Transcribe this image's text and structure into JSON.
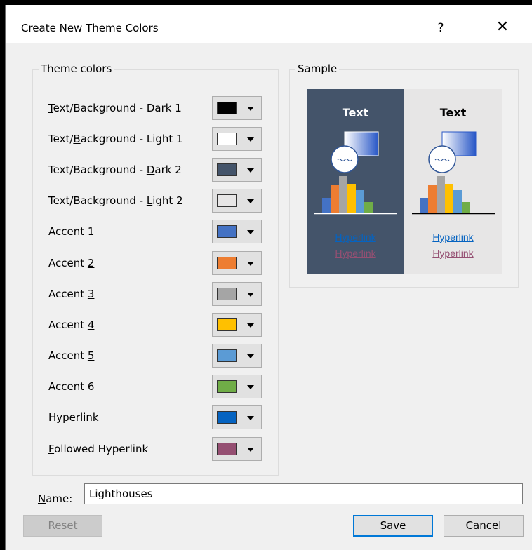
{
  "window": {
    "title": "Create New Theme Colors",
    "help_label": "?",
    "close_label": "✕"
  },
  "theme_colors": {
    "legend": "Theme colors",
    "items": [
      {
        "pre": "",
        "key": "T",
        "post": "ext/Background - Dark 1",
        "color": "#000000"
      },
      {
        "pre": "Text/",
        "key": "B",
        "post": "ackground - Light 1",
        "color": "#ffffff"
      },
      {
        "pre": "Text/Background - ",
        "key": "D",
        "post": "ark 2",
        "color": "#44546a"
      },
      {
        "pre": "Text/Background - ",
        "key": "L",
        "post": "ight 2",
        "color": "#e7e6e6"
      },
      {
        "pre": "Accent ",
        "key": "1",
        "post": "",
        "color": "#4472c4"
      },
      {
        "pre": "Accent ",
        "key": "2",
        "post": "",
        "color": "#ed7d31"
      },
      {
        "pre": "Accent ",
        "key": "3",
        "post": "",
        "color": "#a5a5a5"
      },
      {
        "pre": "Accent ",
        "key": "4",
        "post": "",
        "color": "#ffc000"
      },
      {
        "pre": "Accent ",
        "key": "5",
        "post": "",
        "color": "#5b9bd5"
      },
      {
        "pre": "Accent ",
        "key": "6",
        "post": "",
        "color": "#70ad47"
      },
      {
        "pre": "",
        "key": "H",
        "post": "yperlink",
        "color": "#0563c1"
      },
      {
        "pre": "",
        "key": "F",
        "post": "ollowed Hyperlink",
        "color": "#954f72"
      }
    ]
  },
  "sample": {
    "legend": "Sample",
    "panels": [
      {
        "bg": "#44546a",
        "text": "Text",
        "text_color": "#ffffff",
        "line": "#ffffff",
        "link": "Hyperlink",
        "followed": "Hyperlink"
      },
      {
        "bg": "#e7e6e6",
        "text": "Text",
        "text_color": "#000000",
        "line": "#000000",
        "link": "Hyperlink",
        "followed": "Hyperlink"
      }
    ]
  },
  "name": {
    "label_key": "N",
    "label_rest": "ame:",
    "value": "Lighthouses"
  },
  "buttons": {
    "reset_key": "R",
    "reset_rest": "eset",
    "save_key": "S",
    "save_rest": "ave",
    "cancel": "Cancel"
  }
}
